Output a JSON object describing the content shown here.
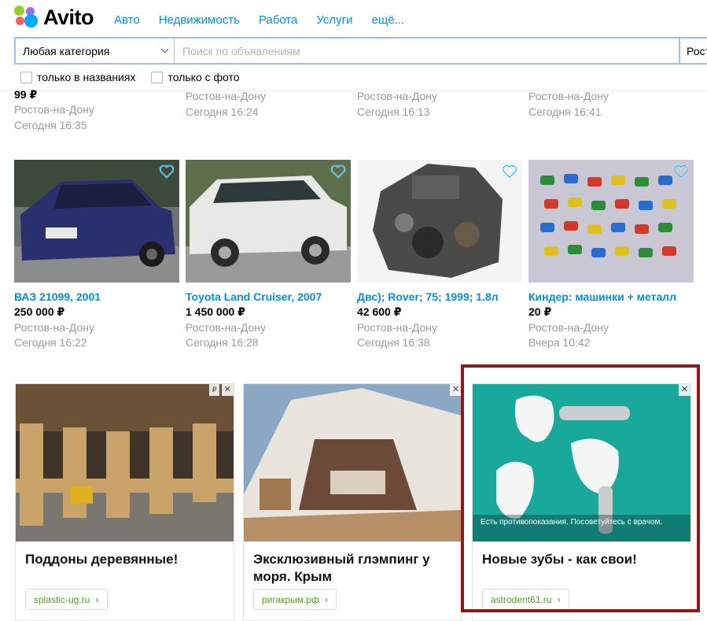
{
  "header": {
    "logo_text": "Avito",
    "nav": [
      "Авто",
      "Недвижимость",
      "Работа",
      "Услуги",
      "ещё..."
    ],
    "category_select": "Любая категория",
    "search_placeholder": "Поиск по объявлениям",
    "city": "Рост",
    "filter_titles": "только в названиях",
    "filter_photo": "только с фото"
  },
  "top_row": [
    {
      "price": "99 ₽",
      "location": "Ростов-на-Дону",
      "time": "Сегодня 16:35"
    },
    {
      "location": "Ростов-на-Дону",
      "time": "Сегодня 16:24"
    },
    {
      "location": "Ростов-на-Дону",
      "time": "Сегодня 16:13"
    },
    {
      "location": "Ростов-на-Дону",
      "time": "Сегодня 16:41"
    }
  ],
  "listings": [
    {
      "title": "ВАЗ 21099, 2001",
      "price": "250 000 ₽",
      "location": "Ростов-на-Дону",
      "time": "Сегодня 16:22"
    },
    {
      "title": "Toyota Land Cruiser, 2007",
      "price": "1 450 000 ₽",
      "location": "Ростов-на-Дону",
      "time": "Сегодня 16:28"
    },
    {
      "title": "Двс); Rover; 75; 1999; 1.8л",
      "price": "42 600 ₽",
      "location": "Ростов-на-Дону",
      "time": "Сегодня 16:38"
    },
    {
      "title": "Киндер: машинки + металл",
      "price": "20 ₽",
      "location": "Ростов-на-Дону",
      "time": "Вчера 10:42"
    }
  ],
  "ads": [
    {
      "title": "Поддоны деревянные!",
      "link": "splastic-ug.ru",
      "close": "✕",
      "badge": "₽"
    },
    {
      "title": "Эксклюзивный глэмпинг у моря. Крым",
      "link": "ригакрым.рф",
      "close": "✕"
    },
    {
      "title": "Новые зубы - как свои!",
      "link": "astrodent61.ru",
      "close": "✕",
      "disclaimer": "Есть противопоказания. Посоветуйтесь с врачом."
    }
  ],
  "colors": {
    "link": "#0091d9",
    "ad_link": "#4ca31c",
    "highlight": "#8b1a1a",
    "border": "#a6c1dd"
  }
}
